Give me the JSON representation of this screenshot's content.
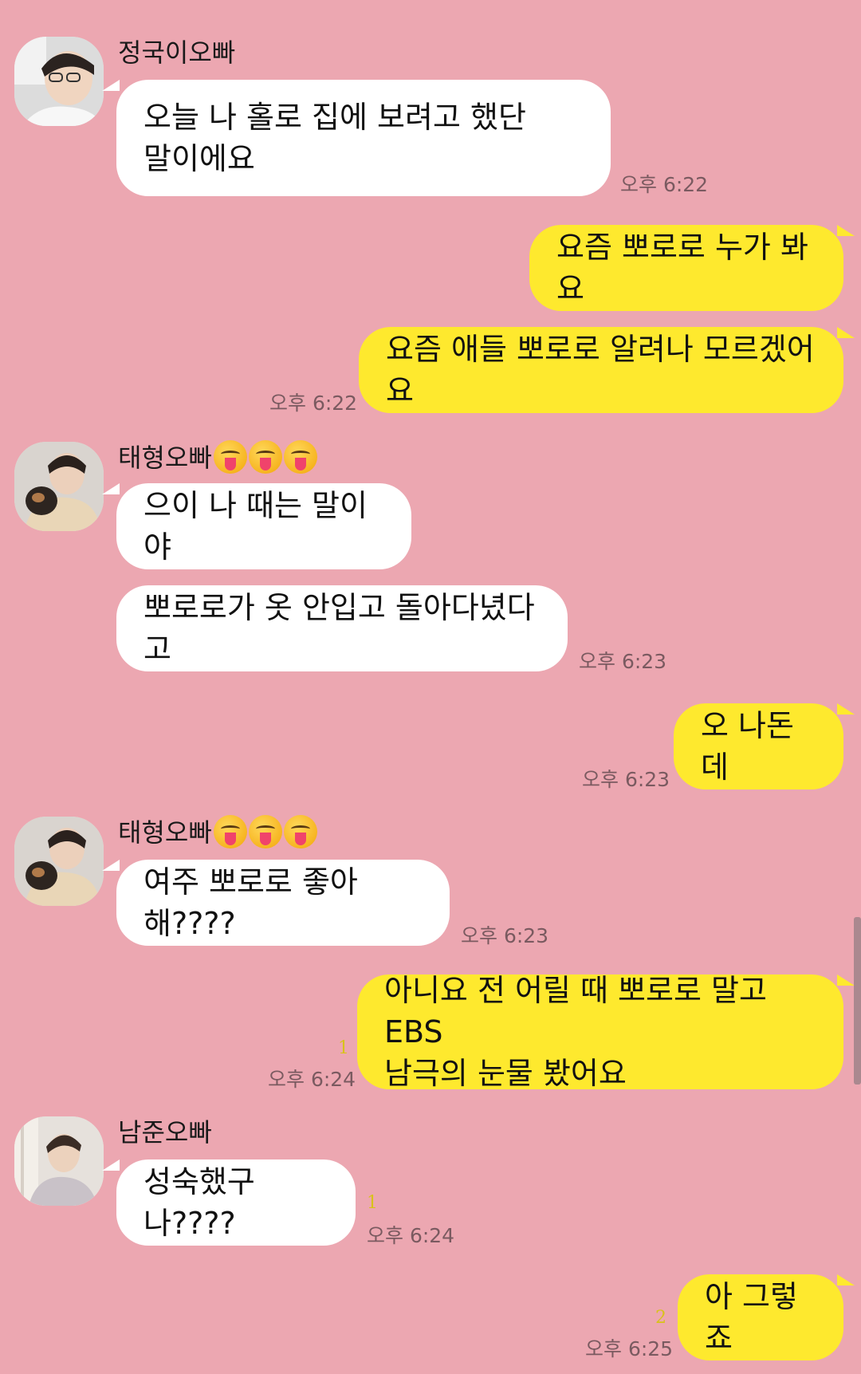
{
  "colors": {
    "background": "#ECA7B1",
    "incoming_bubble": "#FFFFFF",
    "outgoing_bubble": "#FEE92E",
    "unread": "#D8C21A"
  },
  "messages": [
    {
      "sender": "정국이오빠",
      "text_line1": "오늘 나 홀로 집에 보려고 했단",
      "text_line2": "말이에요",
      "time": "오후 6:22"
    },
    {
      "text": "요즘 뽀로로 누가 봐요"
    },
    {
      "text": "요즘 애들 뽀로로 알려나 모르겠어요",
      "time": "오후 6:22"
    },
    {
      "sender": "태형오빠",
      "sender_emoji": "squinting-face-with-tongue",
      "text": "으이 나 때는 말이야"
    },
    {
      "text": "뽀로로가 옷 안입고 돌아다녔다고",
      "time": "오후 6:23"
    },
    {
      "text": "오 나돈데",
      "time": "오후 6:23"
    },
    {
      "sender": "태형오빠",
      "sender_emoji": "squinting-face-with-tongue",
      "text": "여주 뽀로로 좋아해????",
      "time": "오후 6:23"
    },
    {
      "text_line1": "아니요 전 어릴 때 뽀로로 말고 EBS",
      "text_line2": "남극의 눈물 봤어요",
      "unread": "1",
      "time": "오후 6:24"
    },
    {
      "sender": "남준오빠",
      "text": "성숙했구나????",
      "unread": "1",
      "time": "오후 6:24"
    },
    {
      "text": "아 그렇죠",
      "unread": "2",
      "time": "오후 6:25"
    }
  ]
}
